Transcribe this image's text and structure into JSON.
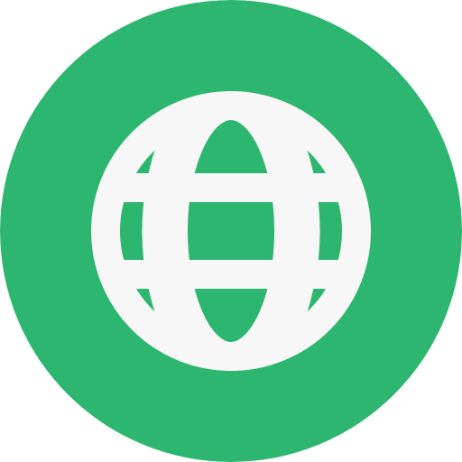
{
  "icon": {
    "name": "globe-icon",
    "colors": {
      "background": "#2DB66F",
      "foreground": "#F7F7F7"
    }
  }
}
